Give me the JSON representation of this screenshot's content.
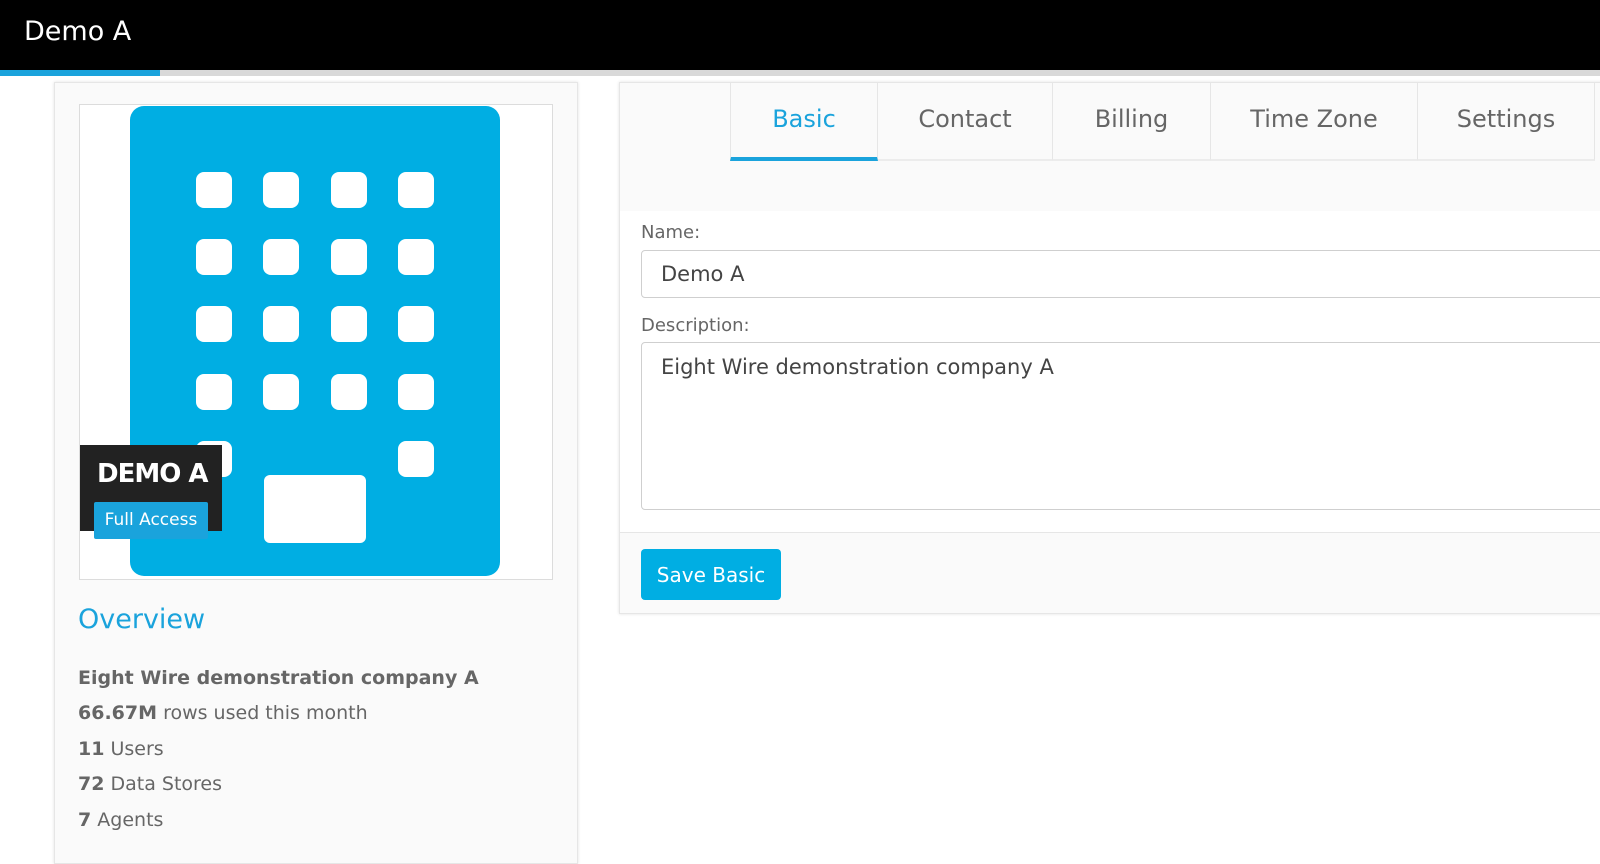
{
  "header": {
    "title": "Demo A",
    "progress_fraction": 0.1,
    "colors": {
      "background": "#000000",
      "accent": "#1aa3dc"
    }
  },
  "company_card": {
    "logo_icon": "building-icon",
    "name": "DEMO A",
    "access_badge": "Full Access",
    "overview_title": "Overview",
    "description": "Eight Wire demonstration company A",
    "stats": {
      "rows_value": "66.67M",
      "rows_label": "rows used this month",
      "users_value": "11",
      "users_label": "Users",
      "data_stores_value": "72",
      "data_stores_label": "Data Stores",
      "agents_value": "7",
      "agents_label": "Agents"
    }
  },
  "settings_panel": {
    "tabs": [
      {
        "label": "Basic",
        "active": true
      },
      {
        "label": "Contact",
        "active": false
      },
      {
        "label": "Billing",
        "active": false
      },
      {
        "label": "Time Zone",
        "active": false
      },
      {
        "label": "Settings",
        "active": false
      }
    ],
    "form": {
      "name_label": "Name:",
      "name_value": "Demo A",
      "description_label": "Description:",
      "description_value": "Eight Wire demonstration company A"
    },
    "save_button_label": "Save Basic"
  }
}
